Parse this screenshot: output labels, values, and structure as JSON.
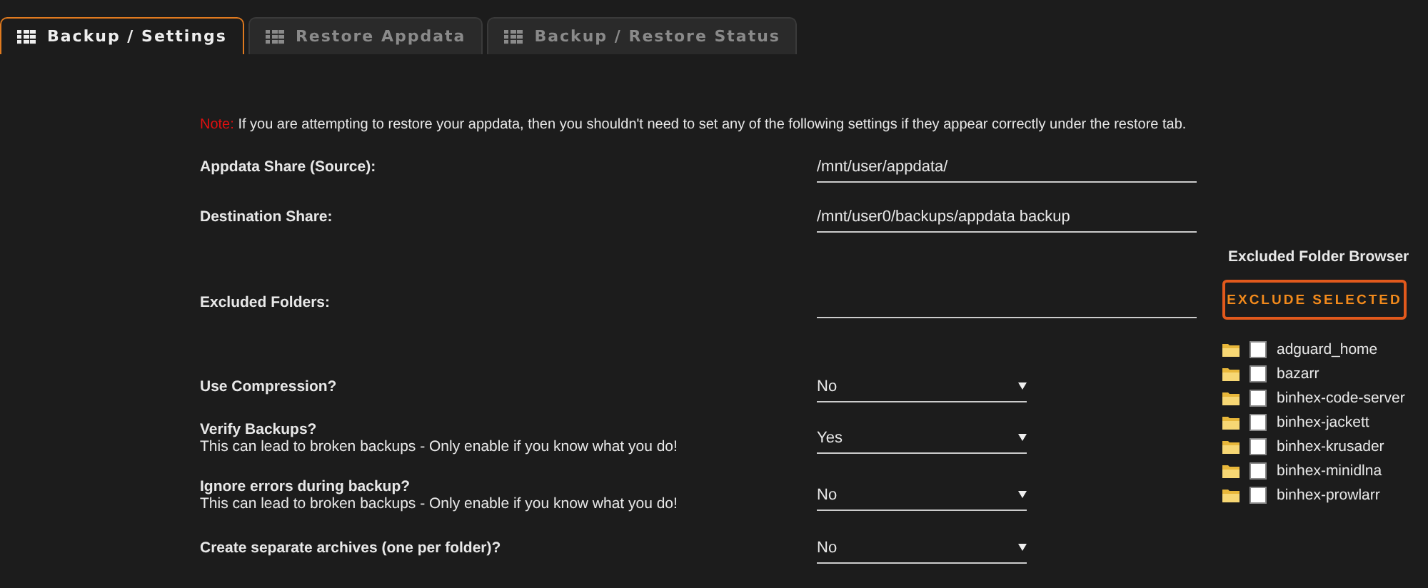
{
  "tabs": [
    {
      "label": "Backup / Settings",
      "selected": true
    },
    {
      "label": "Restore Appdata",
      "selected": false
    },
    {
      "label": "Backup / Restore Status",
      "selected": false
    }
  ],
  "note": {
    "label": "Note:",
    "text": "If you are attempting to restore your appdata, then you shouldn't need to set any of the following settings if they appear correctly under the restore tab."
  },
  "settings": [
    {
      "kind": "text",
      "label": "Appdata Share (Source):",
      "value": "/mnt/user/appdata/"
    },
    {
      "kind": "text",
      "label": "Destination Share:",
      "value": "/mnt/user0/backups/appdata backup"
    },
    {
      "kind": "text",
      "label": "Excluded Folders:"
    },
    {
      "kind": "select",
      "label": "Use Compression?",
      "value": "No"
    },
    {
      "kind": "select",
      "label": "Verify Backups?",
      "hint": "This can lead to broken backups - Only enable if you know what you do!",
      "value": "Yes"
    },
    {
      "kind": "select",
      "label": "Ignore errors during backup?",
      "hint": "This can lead to broken backups - Only enable if you know what you do!",
      "value": "No"
    },
    {
      "kind": "select",
      "label": "Create separate archives (one per folder)?",
      "value": "No"
    }
  ],
  "excluded_folder_browser": {
    "title": "Excluded Folder Browser",
    "button": "EXCLUDE SELECTED",
    "folders": [
      {
        "name": "adguard_home",
        "checked": false
      },
      {
        "name": "bazarr",
        "checked": false
      },
      {
        "name": "binhex-code-server",
        "checked": false
      },
      {
        "name": "binhex-jackett",
        "checked": false
      },
      {
        "name": "binhex-krusader",
        "checked": false
      },
      {
        "name": "binhex-minidlna",
        "checked": false
      },
      {
        "name": "binhex-prowlarr",
        "checked": false
      }
    ]
  }
}
